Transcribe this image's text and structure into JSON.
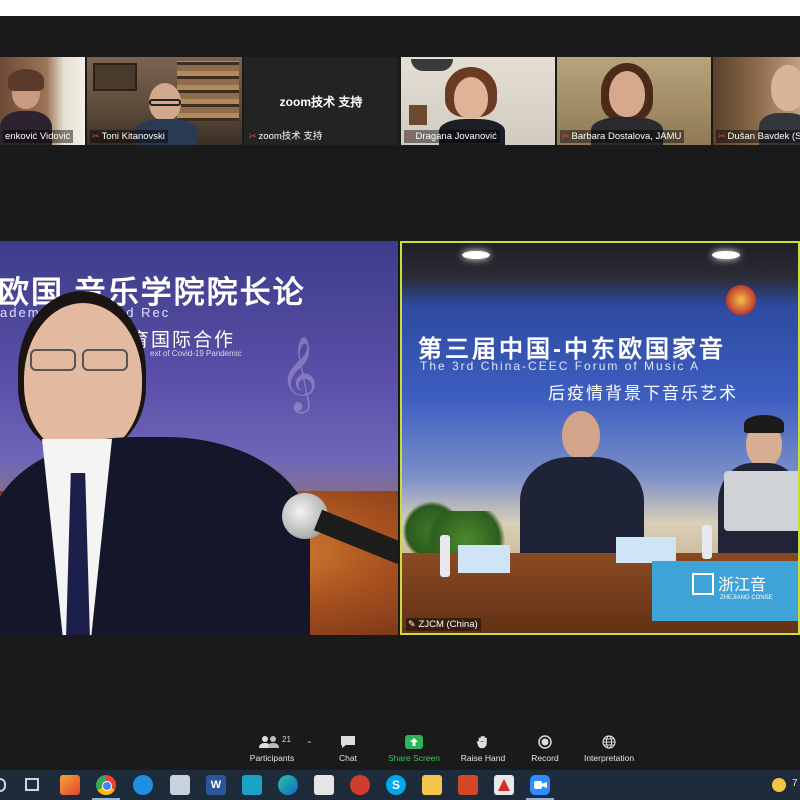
{
  "participants": [
    {
      "name": "enković Vidović"
    },
    {
      "name": "Toni Kitanovski"
    },
    {
      "name": "zoom技术 支持"
    },
    {
      "name": "Dragana Jovanović"
    },
    {
      "name": "Barbara Dostalova, JAMU"
    },
    {
      "name": "Dušan Bavdek (S"
    }
  ],
  "zoom_tile_center_text": "zoom技术 支持",
  "main_left": {
    "banner_line1": "欧国   音乐学院院长论",
    "banner_line2": "     ademy Deans and Rec",
    "banner_line3": "育国际合作",
    "banner_line4": "   ext of Covid-19 Pandemic"
  },
  "main_right": {
    "speaker_name": "ZJCM (China)",
    "banner_line1": "第三届中国-中东欧国家音",
    "banner_line2": "The 3rd China-CEEC Forum of Music A",
    "banner_line3": "后疫情背景下音乐艺术",
    "desk_sign": "浙江音",
    "desk_sign_sub": "ZHEJIANG CONSE"
  },
  "toolbar": {
    "participants_label": "Participants",
    "participants_count": "21",
    "chat_label": "Chat",
    "share_label": "Share Screen",
    "raise_label": "Raise Hand",
    "record_label": "Record",
    "interp_label": "Interpretation"
  },
  "taskbar": {
    "word_label": "W",
    "skype_label": "S",
    "right_text": "7"
  }
}
